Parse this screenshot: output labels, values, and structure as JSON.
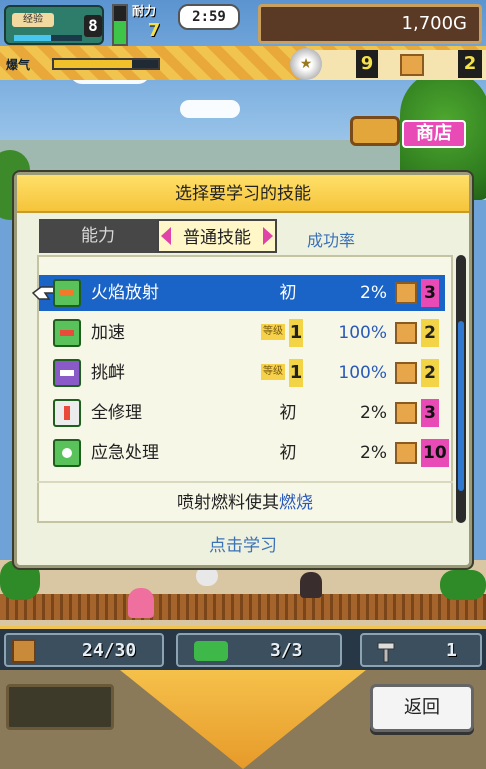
{
  "hud": {
    "badge": "经验",
    "level": "8",
    "level_progress": 0.55,
    "stamina_label": "耐力",
    "stamina_value": "7",
    "stamina_fill": 0.6,
    "clock": "2:59",
    "gold": "1,700G",
    "boost_label": "爆气",
    "boost_fill": 0.75,
    "medals": "9",
    "crates": "2",
    "shop_label": "商店"
  },
  "dialog": {
    "title": "选择要学习的技能",
    "tabs": [
      {
        "label": "能力"
      },
      {
        "label": "普通技能"
      }
    ],
    "rate_header": "成功率",
    "skills": [
      {
        "name": "火焰放射",
        "grade": "初",
        "rate": "2%",
        "cost": "3",
        "selected": true
      },
      {
        "name": "加速",
        "lvl_tag": "等级",
        "lvl": "1",
        "rate": "100%",
        "cost": "2"
      },
      {
        "name": "挑衅",
        "lvl_tag": "等级",
        "lvl": "1",
        "rate": "100%",
        "cost": "2"
      },
      {
        "name": "全修理",
        "grade": "初",
        "rate": "2%",
        "cost": "3"
      },
      {
        "name": "应急处理",
        "grade": "初",
        "rate": "2%",
        "cost": "10"
      }
    ],
    "description_prefix": "喷射燃料使其",
    "description_highlight": "燃烧",
    "learn_link": "点击学习"
  },
  "bottom": {
    "materials": "24/30",
    "vehicles": "3/3",
    "tools": "1"
  },
  "footer": {
    "back_label": "返回"
  }
}
